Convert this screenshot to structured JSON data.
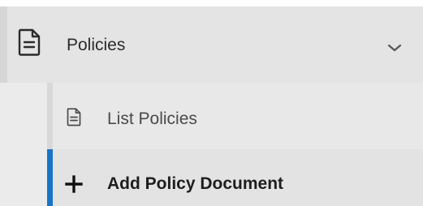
{
  "nav": {
    "group": {
      "label": "Policies",
      "icon": "document-icon",
      "expand_icon": "chevron-down-icon",
      "expanded": true
    },
    "children": [
      {
        "label": "List Policies",
        "icon": "document-icon",
        "active": false
      },
      {
        "label": "Add Policy Document",
        "icon": "plus-icon",
        "active": true
      }
    ]
  },
  "colors": {
    "group_bg": "#e4e4e4",
    "child_bg": "#e8e8e8",
    "active_bg": "#e3e3e3",
    "active_marker": "#1a73c9",
    "text": "#2b2b2b"
  }
}
